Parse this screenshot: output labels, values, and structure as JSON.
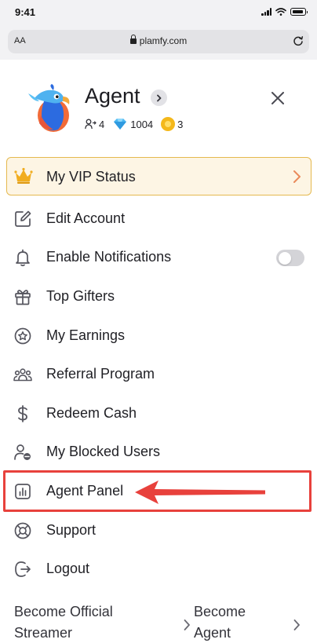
{
  "status_bar": {
    "time": "9:41",
    "icons": [
      "cellular-signal-icon",
      "wifi-icon",
      "battery-icon"
    ]
  },
  "browser": {
    "text_size_label": "AA",
    "url": "plamfy.com",
    "icons": [
      "lock-icon",
      "reload-icon"
    ]
  },
  "profile": {
    "name": "Agent",
    "followers": "4",
    "diamonds": "1004",
    "coins": "3",
    "icons": [
      "avatar-parrot",
      "chevron-right-icon",
      "followers-icon",
      "diamond-icon",
      "coin-icon",
      "close-icon"
    ]
  },
  "vip": {
    "label": "My VIP Status",
    "icon": "crown-icon"
  },
  "menu": [
    {
      "label": "Edit Account",
      "icon": "edit-icon"
    },
    {
      "label": "Enable Notifications",
      "icon": "bell-icon",
      "toggle": "off"
    },
    {
      "label": "Top Gifters",
      "icon": "gift-icon"
    },
    {
      "label": "My Earnings",
      "icon": "star-coin-icon"
    },
    {
      "label": "Referral Program",
      "icon": "users-group-icon"
    },
    {
      "label": "Redeem Cash",
      "icon": "dollar-icon"
    },
    {
      "label": "My Blocked Users",
      "icon": "blocked-user-icon"
    },
    {
      "label": "Agent Panel",
      "icon": "chart-panel-icon"
    },
    {
      "label": "Support",
      "icon": "lifebuoy-icon"
    },
    {
      "label": "Logout",
      "icon": "logout-icon"
    }
  ],
  "footer": {
    "become_streamer": "Become Official Streamer",
    "become_agent": "Become Agent"
  },
  "colors": {
    "highlight": "#e8413c",
    "vip_border": "#e5b94f",
    "vip_background": "#fdf5e4",
    "chevron_accent": "#ea8a5a",
    "crown": "#f1ad1f"
  }
}
